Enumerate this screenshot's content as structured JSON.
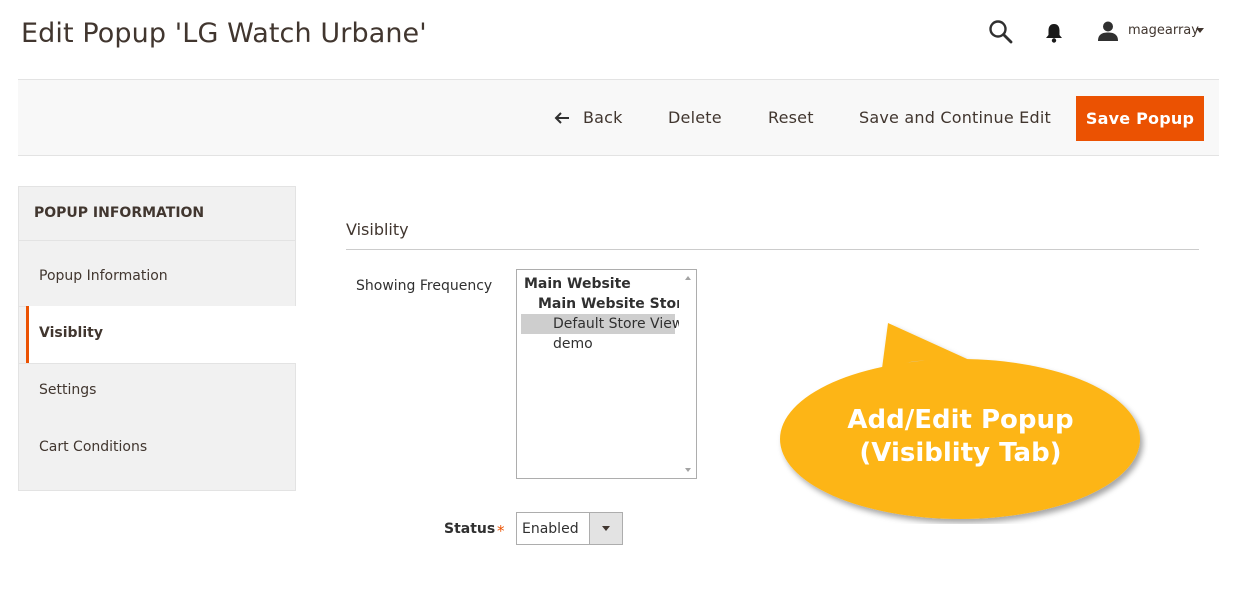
{
  "header": {
    "title": "Edit Popup 'LG Watch Urbane'",
    "user_name": "magearray",
    "icons": {
      "search": "search-icon",
      "notifications": "bell-icon",
      "user": "user-icon",
      "user_menu": "chevron-down-icon"
    }
  },
  "toolbar": {
    "back_label": "Back",
    "delete_label": "Delete",
    "reset_label": "Reset",
    "save_continue_label": "Save and Continue Edit",
    "save_label": "Save Popup",
    "accent_color": "#eb5202"
  },
  "sidebar": {
    "title": "POPUP INFORMATION",
    "items": [
      {
        "label": "Popup Information",
        "active": false
      },
      {
        "label": "Visiblity",
        "active": true
      },
      {
        "label": "Settings",
        "active": false
      },
      {
        "label": "Cart Conditions",
        "active": false
      }
    ]
  },
  "form": {
    "section_title": "Visiblity",
    "frequency_label": "Showing Frequency",
    "frequency_options": [
      {
        "label": "Main Website",
        "selected": false
      },
      {
        "label": "Main Website Store",
        "selected": false
      },
      {
        "label": "Default Store View",
        "selected": true
      },
      {
        "label": "demo",
        "selected": false
      }
    ],
    "status_label": "Status",
    "status_required": "*",
    "status_value": "Enabled"
  },
  "callout": {
    "line1": "Add/Edit Popup",
    "line2": "(Visiblity Tab)",
    "color": "#fdb515"
  }
}
